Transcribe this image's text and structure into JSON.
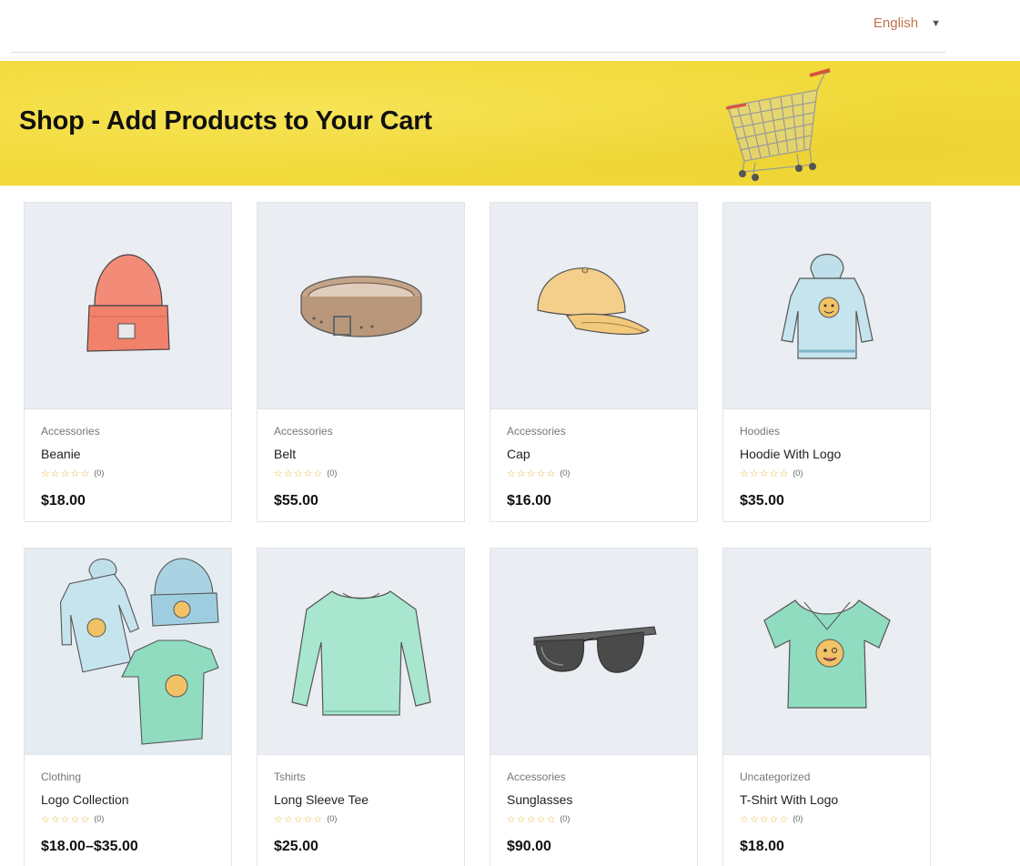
{
  "header": {
    "language": {
      "label": "English",
      "caret": "▼"
    }
  },
  "banner": {
    "title": "Shop - Add Products to Your Cart",
    "image_icon": "shopping-cart"
  },
  "products": [
    {
      "category": "Accessories",
      "name": "Beanie",
      "stars": "☆☆☆☆☆",
      "rating_count": "(0)",
      "price": "$18.00",
      "image": "beanie"
    },
    {
      "category": "Accessories",
      "name": "Belt",
      "stars": "☆☆☆☆☆",
      "rating_count": "(0)",
      "price": "$55.00",
      "image": "belt"
    },
    {
      "category": "Accessories",
      "name": "Cap",
      "stars": "☆☆☆☆☆",
      "rating_count": "(0)",
      "price": "$16.00",
      "image": "cap"
    },
    {
      "category": "Hoodies",
      "name": "Hoodie With Logo",
      "stars": "☆☆☆☆☆",
      "rating_count": "(0)",
      "price": "$35.00",
      "image": "hoodie"
    },
    {
      "category": "Clothing",
      "name": "Logo Collection",
      "stars": "☆☆☆☆☆",
      "rating_count": "(0)",
      "price": "$18.00–$35.00",
      "image": "logo-collection"
    },
    {
      "category": "Tshirts",
      "name": "Long Sleeve Tee",
      "stars": "☆☆☆☆☆",
      "rating_count": "(0)",
      "price": "$25.00",
      "image": "long-sleeve-tee"
    },
    {
      "category": "Accessories",
      "name": "Sunglasses",
      "stars": "☆☆☆☆☆",
      "rating_count": "(0)",
      "price": "$90.00",
      "image": "sunglasses"
    },
    {
      "category": "Uncategorized",
      "name": "T-Shirt With Logo",
      "stars": "☆☆☆☆☆",
      "rating_count": "(0)",
      "price": "$18.00",
      "image": "t-shirt"
    }
  ],
  "colors": {
    "banner_bg": "#f1da3a",
    "accent_link": "#c4714b",
    "card_image_bg": "#eaedf1",
    "star": "#e8b63b"
  }
}
